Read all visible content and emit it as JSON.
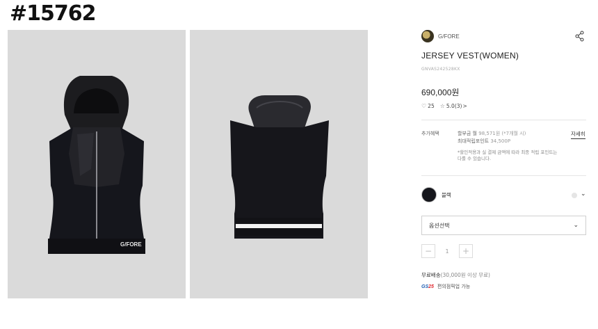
{
  "overlay": {
    "id_tag": "#15762"
  },
  "gallery": {
    "front_logo_text": "G/FORE"
  },
  "product": {
    "brand": "G/FORE",
    "title": "JERSEY VEST(WOMEN)",
    "sku": "GNVAS242528KX",
    "price": "690,000원",
    "likes": "25",
    "rating": "5.0",
    "review_count": "(3)",
    "chevron": ">"
  },
  "benefits": {
    "label": "추가혜택",
    "installment_prefix": "할부금 월",
    "installment_value": "98,571원 (*7개월 시)",
    "points_prefix": "최대적립포인트",
    "points_value": "34,500P",
    "note": "*할인적용과 실 결제 금액에 따라 최종 적립 포인트는 다를 수 있습니다.",
    "detail_link": "자세히"
  },
  "options": {
    "color_name": "블랙",
    "color_hex": "#15161c",
    "select_placeholder": "옵션선택",
    "quantity": "1",
    "minus": "−",
    "plus": "+"
  },
  "shipping": {
    "label": "무료배송",
    "condition": "(30,000원 이상 무료)",
    "gs_logo": "GS",
    "gs_logo_accent": "25",
    "gs_text": "편의점픽업 가능"
  }
}
